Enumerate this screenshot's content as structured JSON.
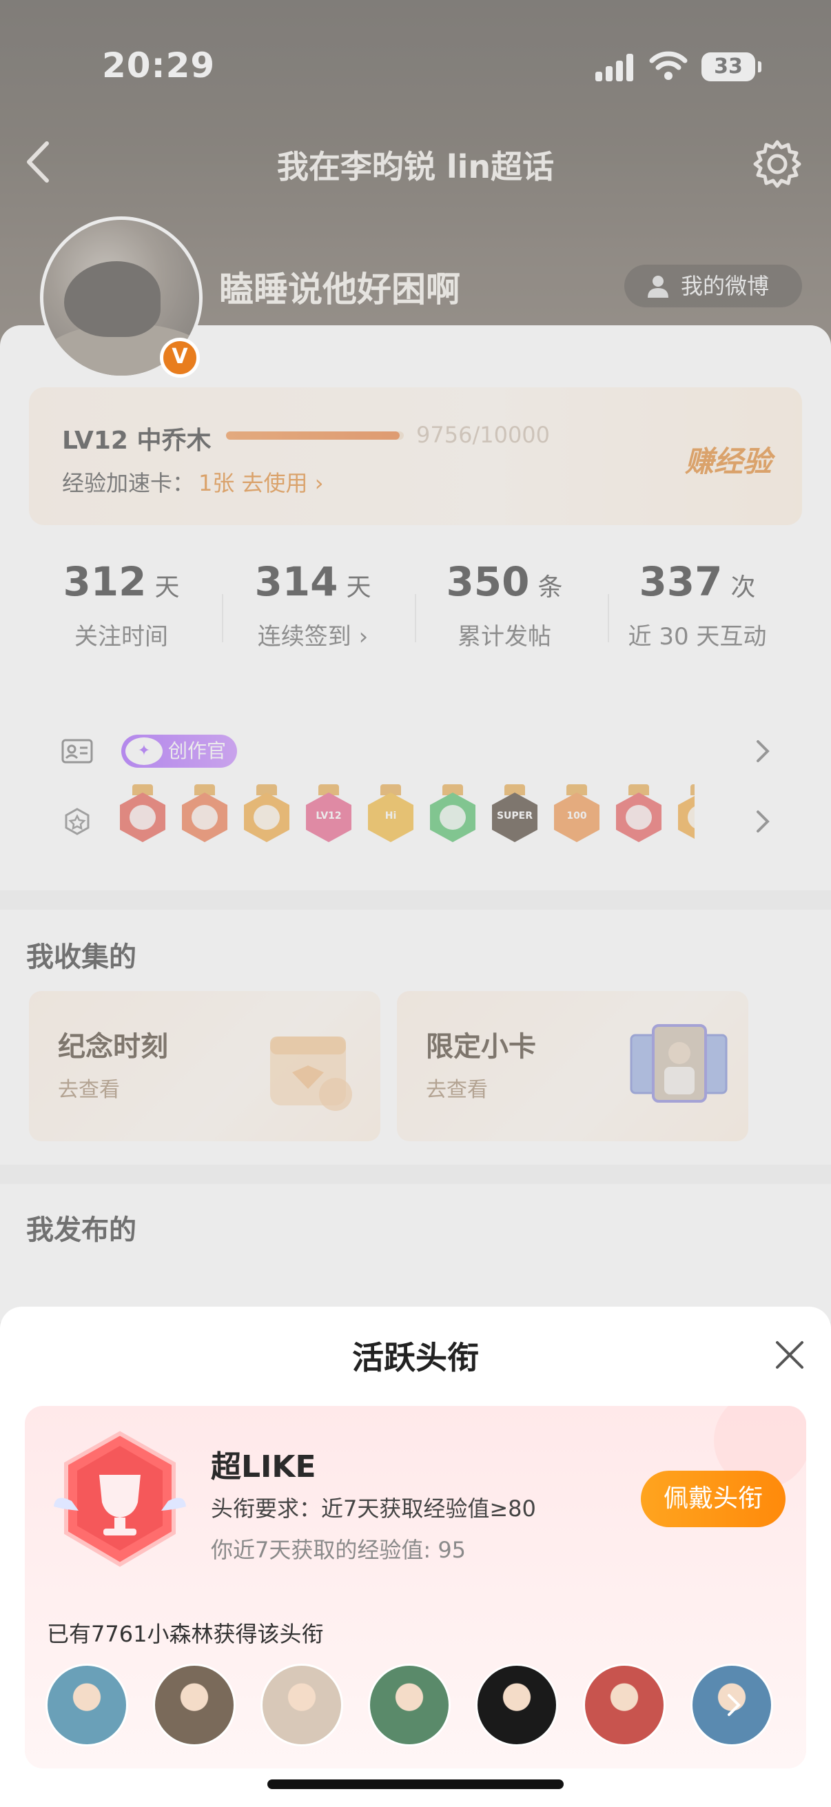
{
  "status_bar": {
    "time": "20:29",
    "battery": "33"
  },
  "header": {
    "title": "我在李昀锐 lin超话",
    "username": "瞌睡说他好困啊",
    "weibo_button": "我的微博"
  },
  "level": {
    "label": "LV12 中乔木",
    "exp": "9756/10000",
    "progress": 0.9756,
    "speed_card_label": "经验加速卡：",
    "speed_card_value": "1张 去使用 ›",
    "earn_label": "赚经验"
  },
  "stats": [
    {
      "value": "312",
      "unit": "天",
      "label": "关注时间"
    },
    {
      "value": "314",
      "unit": "天",
      "label": "连续签到 ›"
    },
    {
      "value": "350",
      "unit": "条",
      "label": "累计发帖"
    },
    {
      "value": "337",
      "unit": "次",
      "label": "近 30 天互动"
    }
  ],
  "creator_badge": "创作官",
  "badges": [
    {
      "icon": "mascot-badge-icon",
      "color": "#e84c3d",
      "text": ""
    },
    {
      "icon": "hand-badge-icon",
      "color": "#ef6a3a",
      "text": ""
    },
    {
      "icon": "crown-badge-icon",
      "color": "#f2a02a",
      "text": ""
    },
    {
      "icon": "lv12-badge-icon",
      "color": "#ea4f7e",
      "text": "LV12"
    },
    {
      "icon": "hi-badge-icon",
      "color": "#f4b226",
      "text": "Hi"
    },
    {
      "icon": "green-hand-badge-icon",
      "color": "#3fba5a",
      "text": ""
    },
    {
      "icon": "super-badge-icon",
      "color": "#3a2a1c",
      "text": "SUPER"
    },
    {
      "icon": "100-days-badge-icon",
      "color": "#f28a3a",
      "text": "100"
    },
    {
      "icon": "trophy-badge-icon",
      "color": "#ea4b4b",
      "text": ""
    },
    {
      "icon": "partial-badge-icon",
      "color": "#f2a02a",
      "text": ""
    }
  ],
  "collected": {
    "title": "我收集的",
    "cards": [
      {
        "title": "纪念时刻",
        "sub": "去查看"
      },
      {
        "title": "限定小卡",
        "sub": "去查看"
      }
    ]
  },
  "published": {
    "title": "我发布的"
  },
  "sheet": {
    "title": "活跃头衔",
    "card": {
      "name": "超LIKE",
      "requirement": "头衔要求：近7天获取经验值≥80",
      "mine": "你近7天获取的经验值: 95",
      "button": "佩戴头衔",
      "owners": "已有7761小森林获得该头衔"
    },
    "avatar_colors": [
      "#6aa0b8",
      "#7a6a5a",
      "#d8c8b8",
      "#5a8a6a",
      "#1a1a1a",
      "#c8544e",
      "#5a8ab0"
    ]
  }
}
